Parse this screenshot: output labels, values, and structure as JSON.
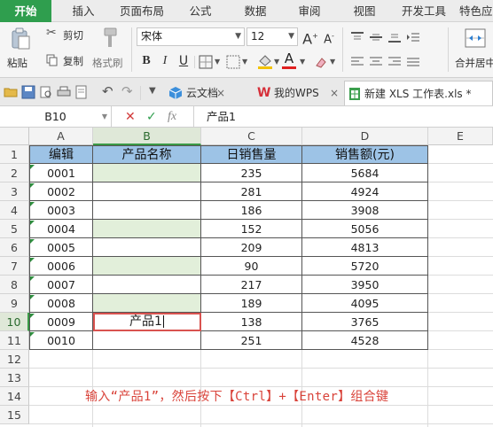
{
  "ribbon": {
    "tabs": [
      "开始",
      "插入",
      "页面布局",
      "公式",
      "数据",
      "审阅",
      "视图",
      "开发工具",
      "特色应"
    ],
    "active_tab": "开始"
  },
  "toolbar": {
    "paste_label": "粘贴",
    "cut_label": "剪切",
    "copy_label": "复制",
    "format_painter_label": "格式刷",
    "font_name": "宋体",
    "font_size": "12",
    "bold": "B",
    "italic": "I",
    "underline": "U",
    "merge_center_label": "合并居中"
  },
  "doc_tabs": {
    "items": [
      {
        "label": "云文档"
      },
      {
        "label": "我的WPS"
      },
      {
        "label": "新建 XLS 工作表.xls *"
      }
    ]
  },
  "formula_bar": {
    "cell_ref": "B10",
    "fx_label": "fx",
    "value": "产品1"
  },
  "grid": {
    "columns": [
      "A",
      "B",
      "C",
      "D",
      "E"
    ],
    "rows": [
      "1",
      "2",
      "3",
      "4",
      "5",
      "6",
      "7",
      "8",
      "9",
      "10",
      "11",
      "12",
      "13",
      "14",
      "15"
    ],
    "header_row": [
      "编辑",
      "产品名称",
      "日销售量",
      "销售额(元)"
    ],
    "data": [
      {
        "a": "0001",
        "b": "",
        "c": "235",
        "d": "5684"
      },
      {
        "a": "0002",
        "b": "",
        "c": "281",
        "d": "4924"
      },
      {
        "a": "0003",
        "b": "",
        "c": "186",
        "d": "3908"
      },
      {
        "a": "0004",
        "b": "",
        "c": "152",
        "d": "5056"
      },
      {
        "a": "0005",
        "b": "",
        "c": "209",
        "d": "4813"
      },
      {
        "a": "0006",
        "b": "",
        "c": "90",
        "d": "5720"
      },
      {
        "a": "0007",
        "b": "",
        "c": "217",
        "d": "3950"
      },
      {
        "a": "0008",
        "b": "",
        "c": "189",
        "d": "4095"
      },
      {
        "a": "0009",
        "b": "产品1",
        "c": "138",
        "d": "3765"
      },
      {
        "a": "0010",
        "b": "",
        "c": "251",
        "d": "4528"
      }
    ],
    "selected_column": "B",
    "selected_row": "10",
    "note": "输入“产品1”，然后按下【Ctrl】+【Enter】组合键"
  },
  "colors": {
    "accent": "#2f9e4e",
    "header_fill": "#9dc3e6",
    "selection_fill": "#e2efda",
    "active_border": "#d9534f",
    "note_text": "#d9433a"
  }
}
